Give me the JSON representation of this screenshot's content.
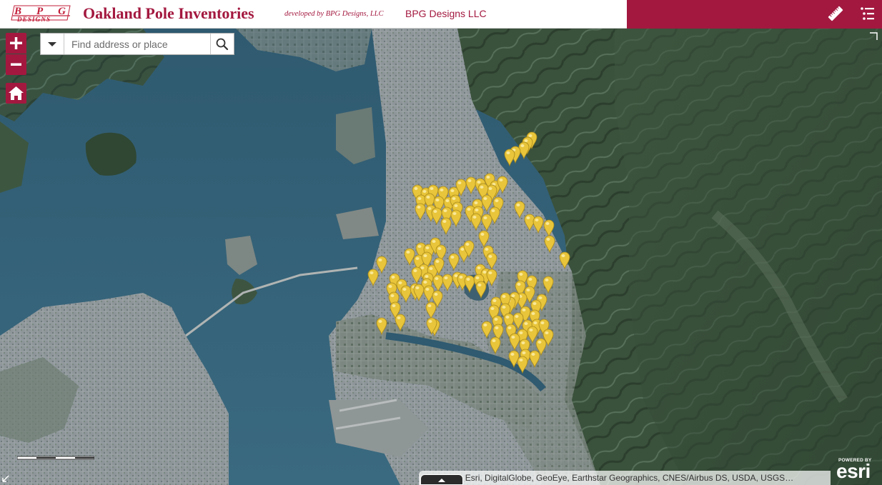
{
  "header": {
    "logo_text": "BPG DESIGNS",
    "title": "Oakland Pole Inventories",
    "developed_by": "developed by BPG Designs, LLC",
    "org_link": "BPG Designs LLC"
  },
  "toolbar": {
    "measure_icon": "ruler-icon",
    "layers_icon": "list-icon"
  },
  "search": {
    "placeholder": "Find address or place"
  },
  "map": {
    "basemap": "satellite imagery",
    "marker_color": "#e8c53a",
    "accent": "#a3183f"
  },
  "attribution": {
    "text": "Source: Esri, DigitalGlobe, GeoEye, Earthstar Geographics, CNES/Airbus DS, USDA, USGS…",
    "powered_by": "POWERED BY",
    "esri": "esri"
  }
}
